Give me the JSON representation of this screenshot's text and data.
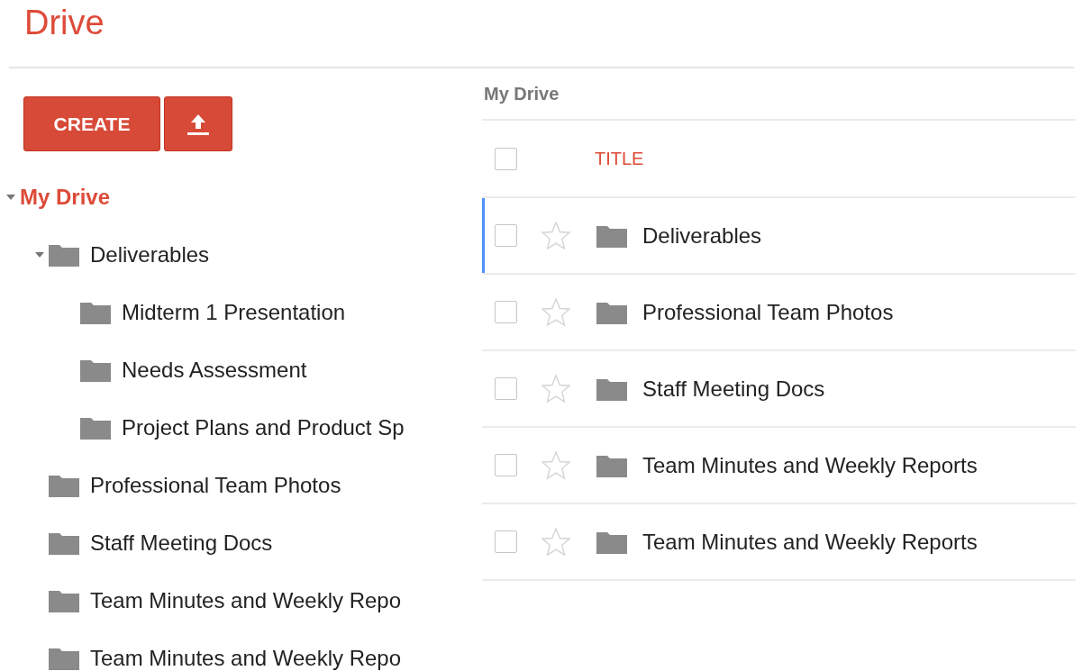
{
  "app_title": "Drive",
  "sidebar": {
    "create_button": "CREATE",
    "tree": [
      {
        "label": "My Drive",
        "selected": true,
        "expanded": true,
        "children": [
          {
            "label": "Deliverables",
            "selected": false,
            "expanded": true,
            "children": [
              {
                "label": "Midterm 1 Presentation",
                "selected": false
              },
              {
                "label": "Needs Assessment",
                "selected": false
              },
              {
                "label": "Project Plans and Product Sp",
                "selected": false
              }
            ]
          },
          {
            "label": "Professional Team Photos",
            "selected": false
          },
          {
            "label": "Staff Meeting Docs",
            "selected": false
          },
          {
            "label": "Team Minutes and Weekly Repo",
            "selected": false
          },
          {
            "label": "Team Minutes and Weekly Repo",
            "selected": false
          }
        ]
      }
    ]
  },
  "breadcrumb": "My Drive",
  "table": {
    "columns": [
      "TITLE"
    ],
    "header_checked": false,
    "rows": [
      {
        "title": "Deliverables",
        "selected": true,
        "checked": false,
        "starred": false
      },
      {
        "title": "Professional Team Photos",
        "selected": false,
        "checked": false,
        "starred": false
      },
      {
        "title": "Staff Meeting Docs",
        "selected": false,
        "checked": false,
        "starred": false
      },
      {
        "title": "Team Minutes and Weekly Reports",
        "selected": false,
        "checked": false,
        "starred": false
      },
      {
        "title": "Team Minutes and Weekly Reports",
        "selected": false,
        "checked": false,
        "starred": false
      }
    ]
  }
}
